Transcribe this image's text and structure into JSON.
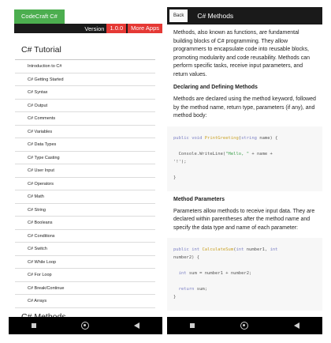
{
  "left": {
    "app_title": "CodeCraft C#",
    "version_label": "Version",
    "version_number": "1.0.0",
    "more_apps": "More Apps",
    "heading": "C# Tutorial",
    "items": [
      "Introduction to C#",
      "C# Getting Started",
      "C# Syntax",
      "C# Output",
      "C# Comments",
      "C# Variables",
      "C# Data Types",
      "C# Type Casting",
      "C# User Input",
      "C# Operators",
      "C# Math",
      "C# String",
      "C# Booleans",
      "C# Conditions",
      "C# Switch",
      "C# While Loop",
      "C# For Loop",
      "C# Break/Continue",
      "C# Arrays"
    ],
    "heading2": "C# Methods"
  },
  "right": {
    "back_label": "Back",
    "title": "C# Methods",
    "intro": "Methods, also known as functions, are fundamental building blocks of C# programming. They allow programmers to encapsulate code into reusable blocks, promoting modularity and code reusability. Methods can perform specific tasks, receive input parameters, and return values.",
    "section1_title": "Declaring and Defining Methods",
    "section1_text": "Methods are declared using the method keyword, followed by the method name, return type, parameters (if any), and method body:",
    "code1": {
      "l1_kw1": "public",
      "l1_kw2": "void",
      "l1_fn": "PrintGreeting",
      "l1_p1": "(",
      "l1_kw3": "string",
      "l1_p2": " name) {",
      "l2_a": "  Console.WriteLine(",
      "l2_str": "\"Hello, \"",
      "l2_b": " + name +",
      "l3": "'!');",
      "l4": "}"
    },
    "section2_title": "Method Parameters",
    "section2_text": "Parameters allow methods to receive input data. They are declared within parentheses after the method name and specify the data type and name of each parameter:",
    "code2": {
      "l1_kw1": "public",
      "l1_kw2": "int",
      "l1_fn": "CalculateSum",
      "l1_p1": "(",
      "l1_kw3": "int",
      "l1_p2": " number1, ",
      "l1_kw4": "int",
      "l2": "number2) {",
      "l3_kw": "  int",
      "l3_rest": " sum = number1 + number2;",
      "l4_kw": "  return",
      "l4_rest": " sum;",
      "l5": "}"
    }
  }
}
